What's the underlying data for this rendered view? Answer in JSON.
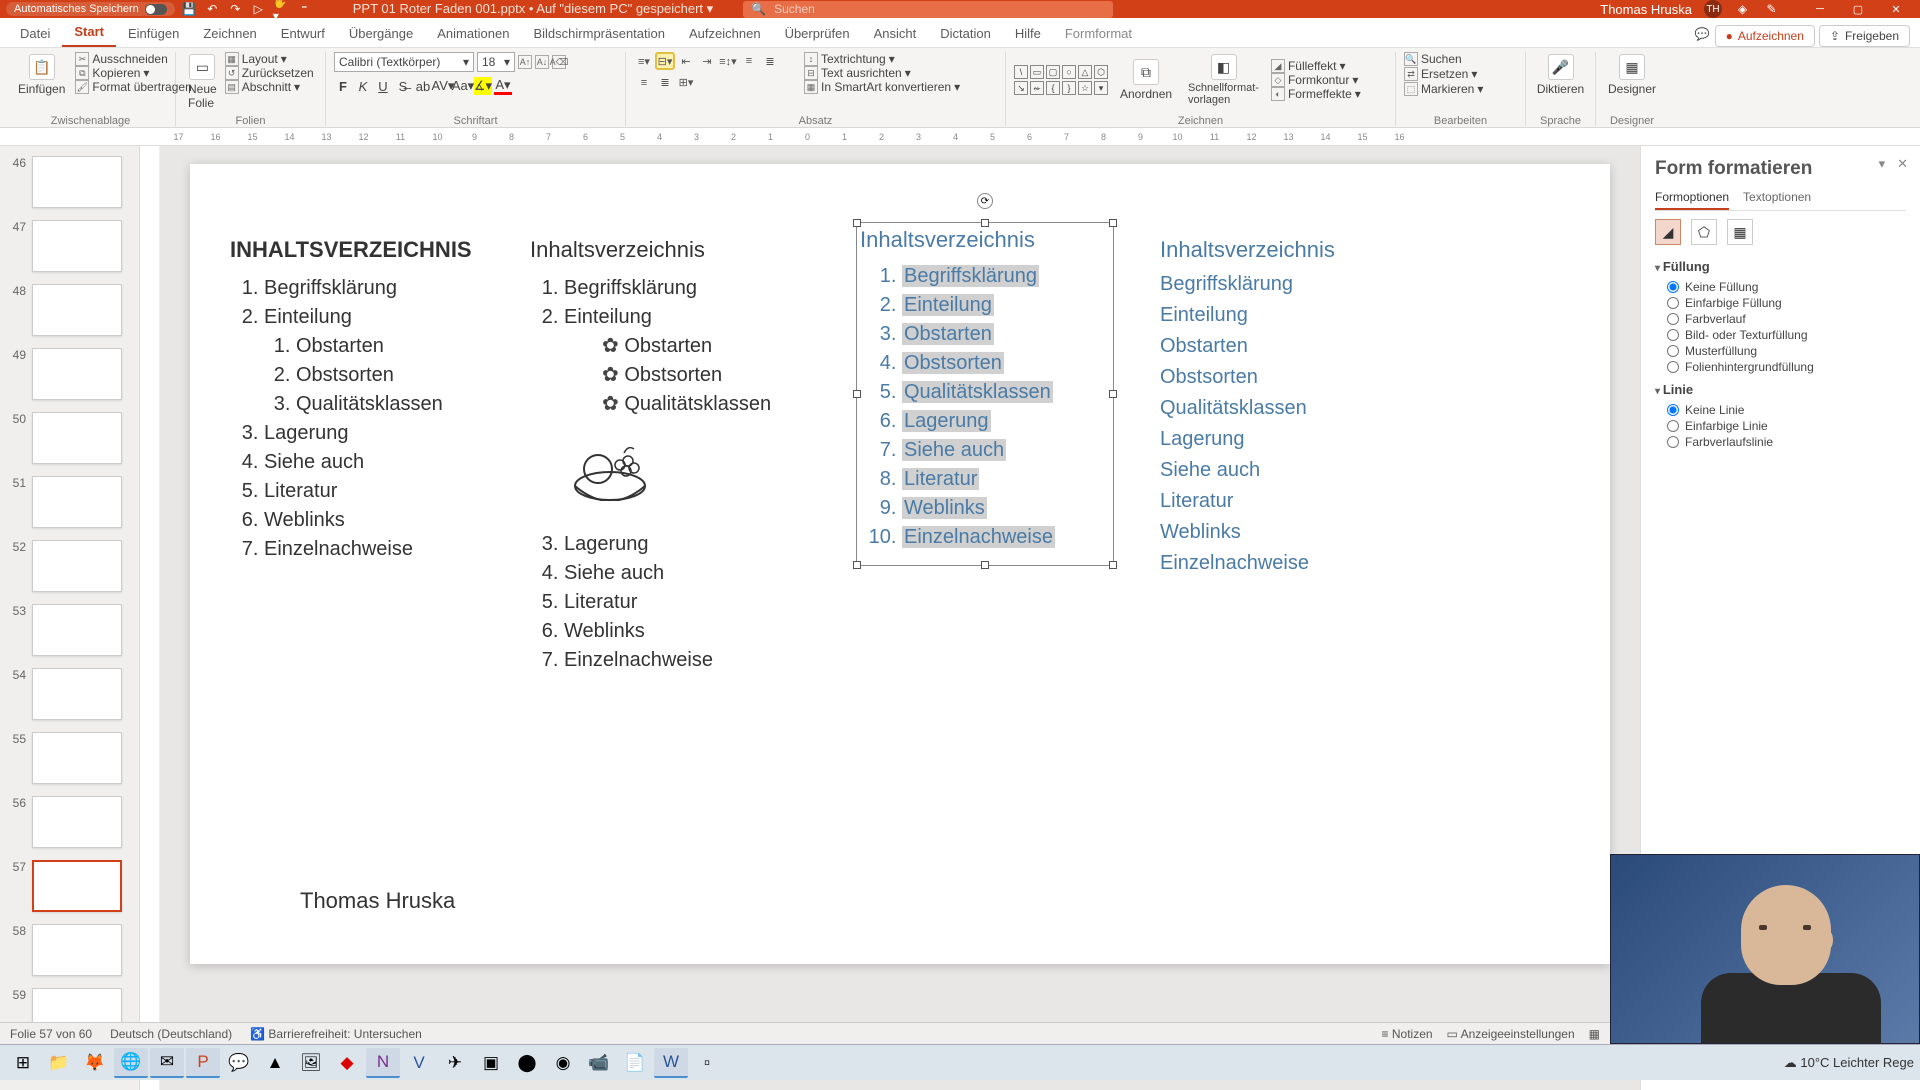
{
  "titlebar": {
    "autosave": "Automatisches Speichern",
    "doc": "PPT 01 Roter Faden 001.pptx • Auf \"diesem PC\" gespeichert ▾",
    "search_placeholder": "Suchen",
    "user": "Thomas Hruska",
    "user_initials": "TH"
  },
  "tabs": {
    "items": [
      "Datei",
      "Start",
      "Einfügen",
      "Zeichnen",
      "Entwurf",
      "Übergänge",
      "Animationen",
      "Bildschirmpräsentation",
      "Aufzeichnen",
      "Überprüfen",
      "Ansicht",
      "Dictation",
      "Hilfe"
    ],
    "context": "Formformat",
    "active": 1,
    "record": "Aufzeichnen",
    "share": "Freigeben"
  },
  "ribbon": {
    "clipboard": {
      "paste": "Einfügen",
      "cut": "Ausschneiden",
      "copy": "Kopieren",
      "fmt": "Format übertragen",
      "label": "Zwischenablage"
    },
    "slides": {
      "new": "Neue\nFolie",
      "layout": "Layout",
      "reset": "Zurücksetzen",
      "section": "Abschnitt",
      "label": "Folien"
    },
    "font": {
      "name": "Calibri (Textkörper)",
      "size": "18",
      "label": "Schriftart"
    },
    "paragraph": {
      "textdir": "Textrichtung",
      "align": "Text ausrichten",
      "smartart": "In SmartArt konvertieren",
      "label": "Absatz"
    },
    "drawing": {
      "arrange": "Anordnen",
      "quick": "Schnellformat-\nvorlagen",
      "fill": "Fülleffekt",
      "outline": "Formkontur",
      "effects": "Formeffekte",
      "label": "Zeichnen"
    },
    "editing": {
      "find": "Suchen",
      "replace": "Ersetzen",
      "select": "Markieren",
      "label": "Bearbeiten"
    },
    "voice": {
      "dictate": "Diktieren",
      "label": "Sprache"
    },
    "designer": {
      "designer": "Designer",
      "label": "Designer"
    }
  },
  "ruler": [
    "17",
    "16",
    "15",
    "14",
    "13",
    "12",
    "11",
    "10",
    "9",
    "8",
    "7",
    "6",
    "5",
    "4",
    "3",
    "2",
    "1",
    "0",
    "1",
    "2",
    "3",
    "4",
    "5",
    "6",
    "7",
    "8",
    "9",
    "10",
    "11",
    "12",
    "13",
    "14",
    "15",
    "16"
  ],
  "thumbs": [
    46,
    47,
    48,
    49,
    50,
    51,
    52,
    53,
    54,
    55,
    56,
    57,
    58,
    59
  ],
  "thumbs_sel": 57,
  "slide": {
    "col1": {
      "title": "INHALTSVERZEICHNIS",
      "items": [
        "Begriffsklärung",
        "Einteilung"
      ],
      "sub": [
        "Obstarten",
        "Obstsorten",
        "Qualitätsklassen"
      ],
      "rest": [
        "Lagerung",
        "Siehe auch",
        "Literatur",
        "Weblinks",
        "Einzelnachweise"
      ]
    },
    "col2": {
      "title": "Inhaltsverzeichnis",
      "items": [
        "Begriffsklärung",
        "Einteilung"
      ],
      "sub": [
        "Obstarten",
        "Obstsorten",
        "Qualitätsklassen"
      ],
      "rest": [
        "Lagerung",
        "Siehe auch",
        "Literatur",
        "Weblinks",
        "Einzelnachweise"
      ]
    },
    "col3": {
      "title": "Inhaltsverzeichnis",
      "items": [
        "Begriffsklärung",
        "Einteilung",
        "Obstarten",
        "Obstsorten",
        "Qualitätsklassen",
        "Lagerung",
        "Siehe auch",
        "Literatur",
        "Weblinks",
        "Einzelnachweise"
      ]
    },
    "col4": {
      "title": "Inhaltsverzeichnis",
      "items": [
        "Begriffsklärung",
        "Einteilung",
        "Obstarten",
        "Obstsorten",
        "Qualitätsklassen",
        "Lagerung",
        "Siehe auch",
        "Literatur",
        "Weblinks",
        "Einzelnachweise"
      ]
    },
    "author": "Thomas Hruska"
  },
  "panel": {
    "title": "Form formatieren",
    "tab1": "Formoptionen",
    "tab2": "Textoptionen",
    "fill": {
      "title": "Füllung",
      "opts": [
        "Keine Füllung",
        "Einfarbige Füllung",
        "Farbverlauf",
        "Bild- oder Texturfüllung",
        "Musterfüllung",
        "Folienhintergrundfüllung"
      ],
      "sel": 0
    },
    "line": {
      "title": "Linie",
      "opts": [
        "Keine Linie",
        "Einfarbige Linie",
        "Farbverlaufslinie"
      ],
      "sel": 0
    }
  },
  "status": {
    "slide": "Folie 57 von 60",
    "lang": "Deutsch (Deutschland)",
    "access": "Barrierefreiheit: Untersuchen",
    "notes": "Notizen",
    "display": "Anzeigeeinstellungen"
  },
  "taskbar": {
    "weather": "10°C  Leichter Rege"
  }
}
